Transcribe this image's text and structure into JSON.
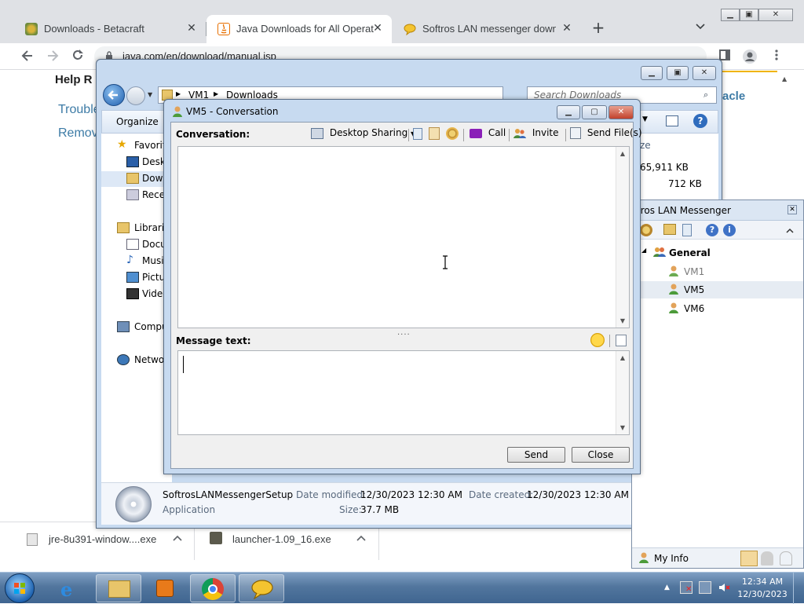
{
  "chrome": {
    "tabs": [
      {
        "title": "Downloads - Betacraft",
        "icon": "betacraft-favicon"
      },
      {
        "title": "Java Downloads for All Operating",
        "icon": "java-favicon",
        "active": true
      },
      {
        "title": "Softros LAN messenger downloa",
        "icon": "softros-favicon"
      }
    ],
    "close_glyph": "✕",
    "new_tab": "+",
    "tab_menu": "⌄",
    "url": "java.com/en/download/manual.jsp",
    "page": {
      "help": "Help R",
      "trouble": "Trouble",
      "remove": "Remov",
      "oracle": "acle"
    },
    "downloads": [
      {
        "name": "jre-8u391-window....exe"
      },
      {
        "name": "launcher-1.09_16.exe"
      }
    ]
  },
  "explorer": {
    "breadcrumb": [
      "VM1",
      "Downloads"
    ],
    "search_placeholder": "Search Downloads",
    "organize_label": "Organize",
    "nav": {
      "favorites": "Favorit",
      "desktop": "Deskt",
      "downloads": "Down",
      "recent": "Recer",
      "libraries": "Librarie",
      "documents": "Docu",
      "music": "Musi",
      "pictures": "Pictu",
      "videos": "Videc",
      "computer": "Compu",
      "network": "Networ"
    },
    "right_col": {
      "header": "ze",
      "size1": "65,911 KB",
      "size2": "712 KB"
    },
    "details": {
      "name": "SoftrosLANMessengerSetup",
      "type": "Application",
      "modified_label": "Date modified:",
      "modified": "12/30/2023 12:30 AM",
      "created_label": "Date created:",
      "created": "12/30/2023 12:30 AM",
      "size_label": "Size:",
      "size": "37.7 MB"
    }
  },
  "conversation": {
    "title": "VM5 - Conversation",
    "label": "Conversation:",
    "desktop_sharing": "Desktop Sharing",
    "call": "Call",
    "invite": "Invite",
    "send_files": "Send File(s)",
    "message_label": "Message text:",
    "grip": "....",
    "send": "Send",
    "close": "Close"
  },
  "softros": {
    "title": "ftros LAN Messenger",
    "group": "General",
    "users": [
      "VM1",
      "VM5",
      "VM6"
    ],
    "my_info": "My Info"
  },
  "taskbar": {
    "time": "12:34 AM",
    "date": "12/30/2023"
  },
  "colors": {
    "accent": "#3d7ba6",
    "taskbar": "#52769e"
  }
}
